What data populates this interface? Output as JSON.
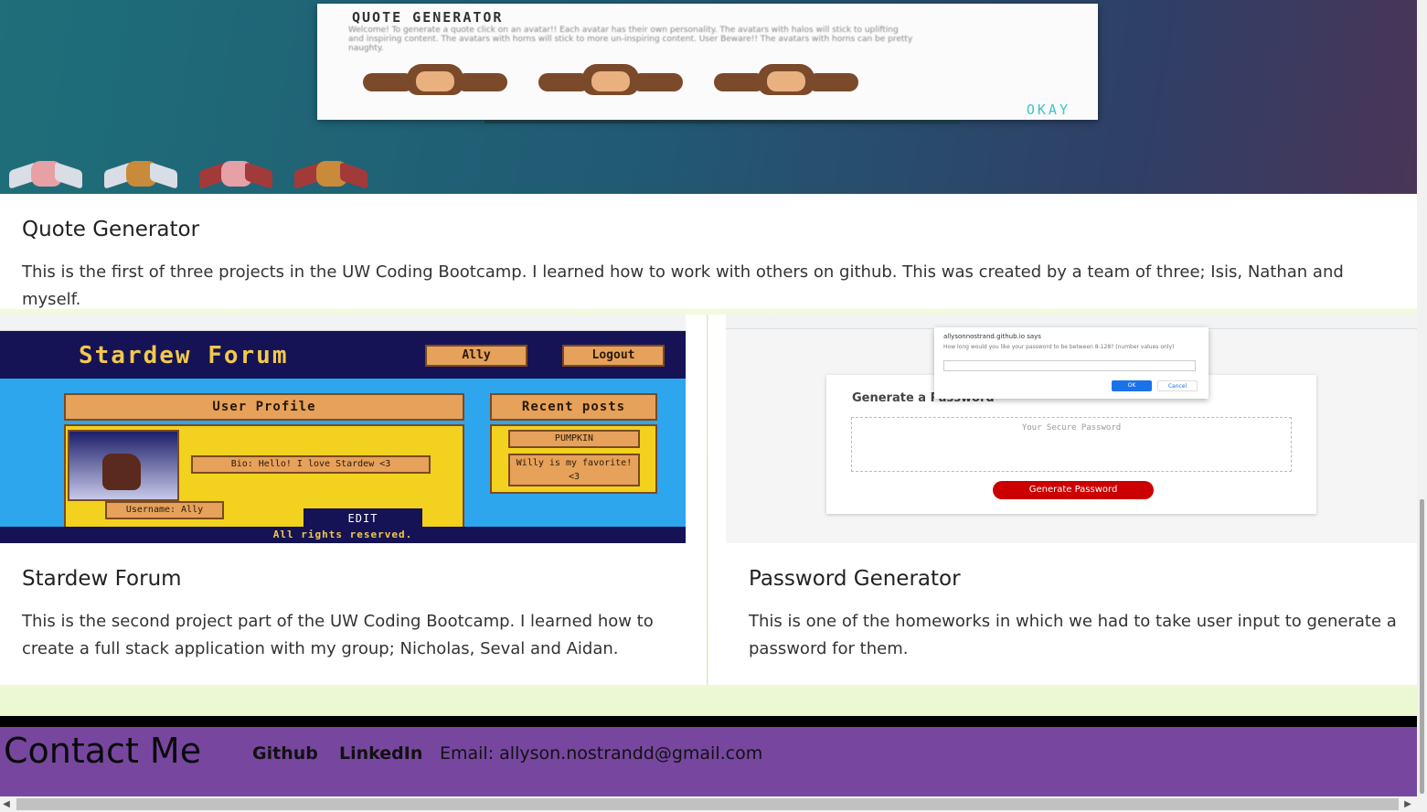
{
  "projects": [
    {
      "title": "Quote Generator",
      "description": "This is the first of three projects in the UW Coding Bootcamp. I learned how to work with others on github. This was created by a team of three; Isis, Nathan and myself.",
      "screenshot": {
        "modal_title": "QUOTE GENERATOR",
        "modal_text": "Welcome! To generate a quote click on an avatar!! Each avatar has their own personality. The avatars with halos will stick to uplifting and inspiring content. The avatars with horns will stick to more un-inspiring content. User Beware!! The avatars with horns can be pretty naughty.",
        "okay_label": "OKAY"
      }
    },
    {
      "title": "Stardew Forum",
      "description": "This is the second project part of the UW Coding Bootcamp. I learned how to create a full stack application with my group; Nicholas, Seval and Aidan.",
      "screenshot": {
        "site_title": "Stardew Forum",
        "user_button": "Ally",
        "logout_button": "Logout",
        "profile_tab": "User Profile",
        "recent_tab": "Recent posts",
        "bio": "Bio: Hello! I love Stardew <3",
        "username": "Username: Ally",
        "edit_label": "EDIT",
        "post1": "PUMPKIN",
        "post2": "Willy is my favorite! <3",
        "footer": "All rights reserved."
      }
    },
    {
      "title": "Password Generator",
      "description": "This is one of the homeworks in which we had to take user input to generate a password for them.",
      "screenshot": {
        "heading": "Generate a Password",
        "placeholder": "Your Secure Password",
        "button": "Generate Password",
        "dialog_title": "allysonnostrand.github.io says",
        "dialog_message": "How long would you like your password to be between 8-128? (number values only)",
        "dialog_ok": "OK",
        "dialog_cancel": "Cancel"
      }
    }
  ],
  "footer": {
    "title": "Contact Me",
    "github": "Github",
    "linkedin": "LinkedIn",
    "email": "Email: allyson.nostrandd@gmail.com"
  },
  "colors": {
    "footer_bg": "#77479f",
    "stardew_header": "#151355",
    "stardew_gold": "#f2c94c",
    "pw_button": "#cc0000"
  }
}
